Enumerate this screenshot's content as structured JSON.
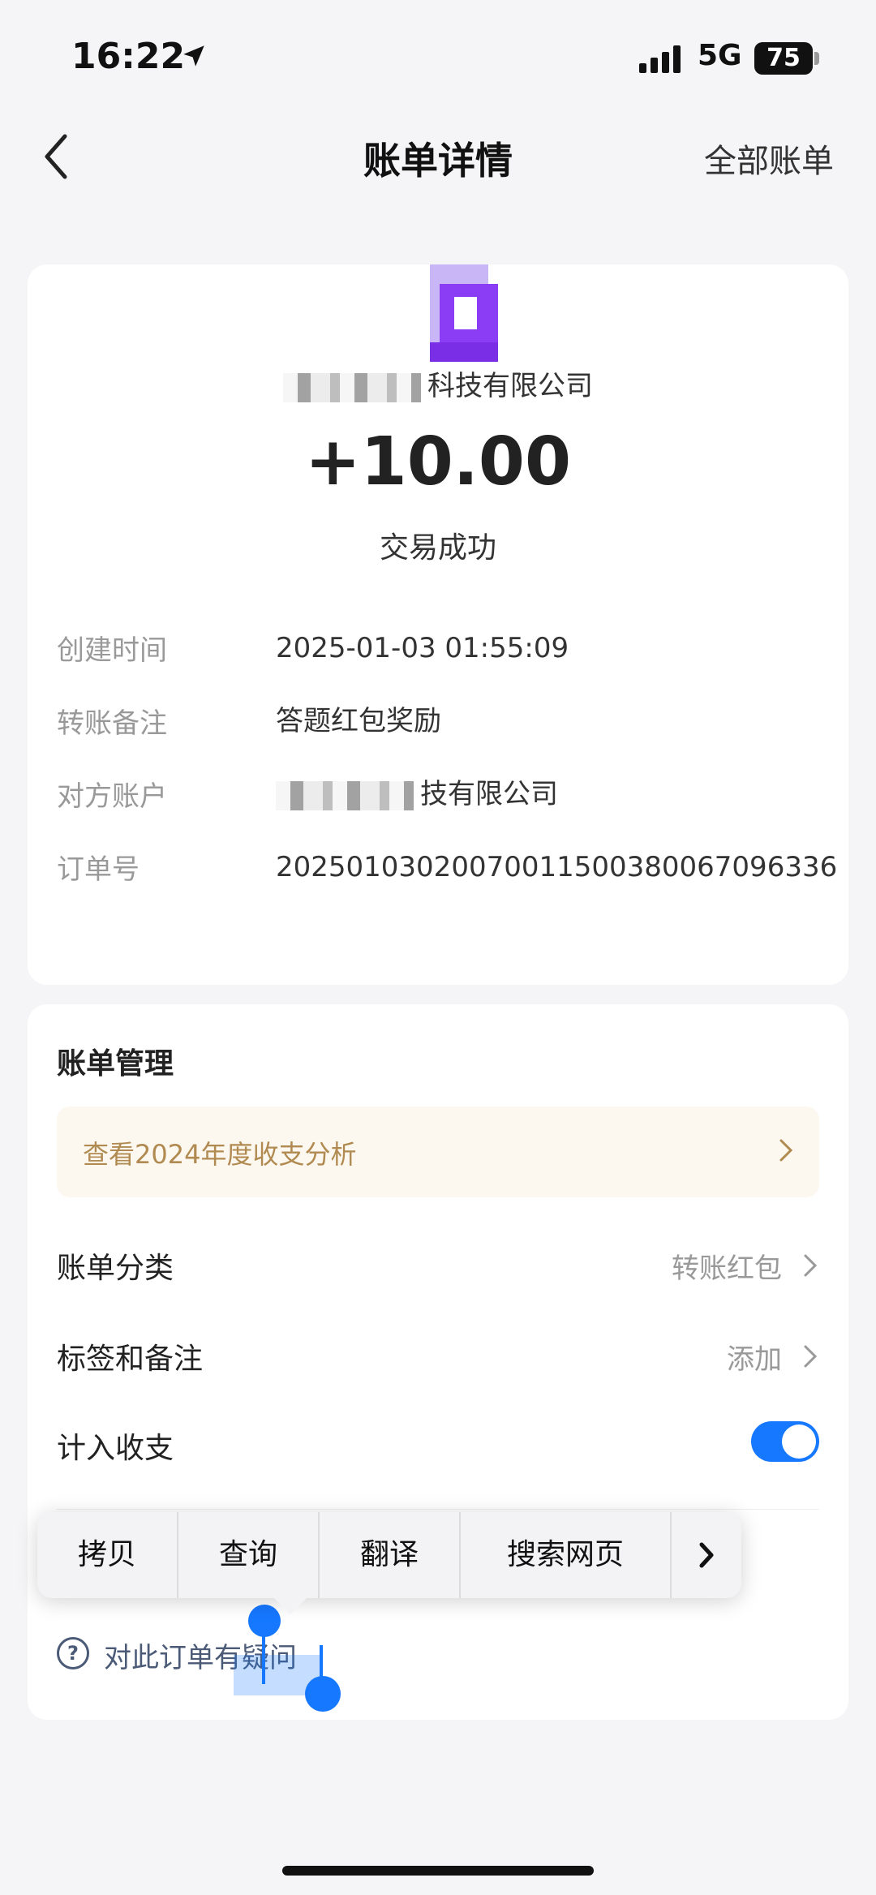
{
  "status_bar": {
    "time": "16:22",
    "network": "5G",
    "battery": "75"
  },
  "nav": {
    "title": "账单详情",
    "right_label": "全部账单"
  },
  "summary": {
    "merchant_name": "科技有限公司",
    "amount": "+10.00",
    "status": "交易成功"
  },
  "details": [
    {
      "label": "创建时间",
      "value": "2025-01-03 01:55:09"
    },
    {
      "label": "转账备注",
      "value": "答题红包奖励"
    },
    {
      "label": "对方账户",
      "value": "技有限公司"
    },
    {
      "label": "订单号",
      "value": "20250103020070011500380067096336"
    }
  ],
  "management": {
    "title": "账单管理",
    "analysis_text": "查看2024年度收支分析",
    "rows": [
      {
        "label": "账单分类",
        "value": "转账红包"
      },
      {
        "label": "标签和备注",
        "value": "添加"
      },
      {
        "label": "计入收支"
      }
    ],
    "include_in_stats": true,
    "question_text": "对此订单有疑问"
  },
  "context_menu": {
    "items": [
      "拷贝",
      "查询",
      "翻译",
      "搜索网页"
    ]
  },
  "colors": {
    "accent": "#1677ff",
    "analysis_text": "#b08a50",
    "analysis_bg": "#fdf8ef",
    "merchant_logo": "#8b3df5"
  },
  "icons": {
    "back": "chevron-left-icon",
    "location": "location-arrow-icon",
    "signal": "signal-bars-icon",
    "question": "question-circle-icon",
    "more": "chevron-right-icon"
  }
}
